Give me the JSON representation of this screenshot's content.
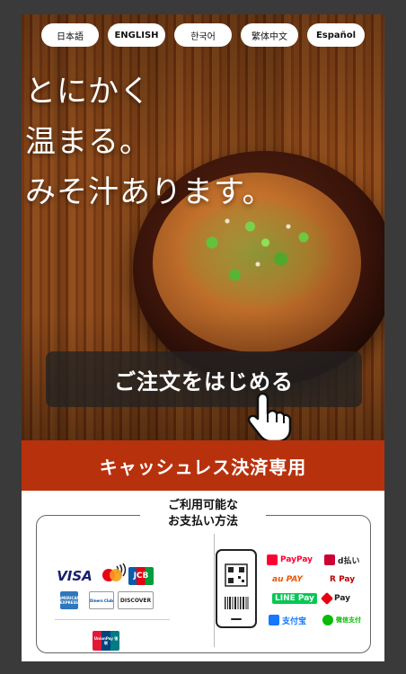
{
  "languages": [
    {
      "label": "日本語"
    },
    {
      "label": "ENGLISH"
    },
    {
      "label": "한국어"
    },
    {
      "label": "繁体中文"
    },
    {
      "label": "Español"
    }
  ],
  "hero": {
    "headline_lines": [
      "とにかく",
      "温まる。",
      "みそ汁あります。"
    ],
    "order_button_label": "ご注文をはじめる"
  },
  "cashless_banner": "キャッシュレス決済専用",
  "payment": {
    "title_line1": "ご利用可能な",
    "title_line2": "お支払い方法",
    "cards": [
      {
        "label": "VISA",
        "color": "#1a1f71"
      },
      {
        "label": "mastercard",
        "color": "#eb001b"
      },
      {
        "label": "JCB",
        "color": "#0a5bab"
      },
      {
        "label": "AMERICAN EXPRESS",
        "color": "#2e77bc"
      },
      {
        "label": "Diners Club",
        "color": "#004a97"
      },
      {
        "label": "DISCOVER",
        "color": "#f76f20"
      },
      {
        "label": "UnionPay 银联",
        "color": "#e21836"
      }
    ],
    "wallets": [
      {
        "label": "PayPay",
        "color": "#ff0033"
      },
      {
        "label": "d払い",
        "color": "#cc0033"
      },
      {
        "label": "au PAY",
        "color": "#eb5505"
      },
      {
        "label": "R Pay",
        "color": "#bf0000"
      },
      {
        "label": "LINE Pay",
        "color": "#06c755"
      },
      {
        "label": "Pay",
        "color": "#e60012"
      },
      {
        "label": "支付宝",
        "color": "#1677ff"
      },
      {
        "label": "微信支付",
        "color": "#09bb07"
      }
    ]
  },
  "colors": {
    "banner": "#b8310d",
    "order_button_bg": "#232323"
  }
}
